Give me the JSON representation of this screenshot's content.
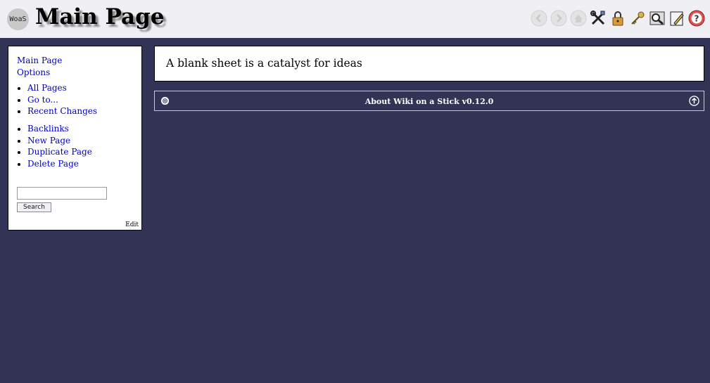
{
  "header": {
    "logo_text": "WoaS",
    "title": "Main Page",
    "toolbar": [
      {
        "icon": "back-icon",
        "enabled": false
      },
      {
        "icon": "forward-icon",
        "enabled": false
      },
      {
        "icon": "home-icon",
        "enabled": false
      },
      {
        "icon": "tools-icon",
        "enabled": true
      },
      {
        "icon": "lock-icon",
        "enabled": true
      },
      {
        "icon": "key-icon",
        "enabled": true
      },
      {
        "icon": "search-icon",
        "enabled": true
      },
      {
        "icon": "edit-icon",
        "enabled": true
      },
      {
        "icon": "help-icon",
        "enabled": true
      }
    ]
  },
  "sidebar": {
    "top_links": [
      "Main Page",
      "Options"
    ],
    "list1": [
      "All Pages",
      "Go to...",
      "Recent Changes"
    ],
    "list2": [
      "Backlinks",
      "New Page",
      "Duplicate Page",
      "Delete Page"
    ],
    "search_value": "",
    "search_button": "Search",
    "edit_link": "Edit"
  },
  "content": {
    "text": "A blank sheet is a catalyst for ideas"
  },
  "about": {
    "title": "About Wiki on a Stick v0.12.0"
  },
  "colors": {
    "background": "#333355",
    "header": "#efeff4",
    "link": "#0000cc"
  }
}
